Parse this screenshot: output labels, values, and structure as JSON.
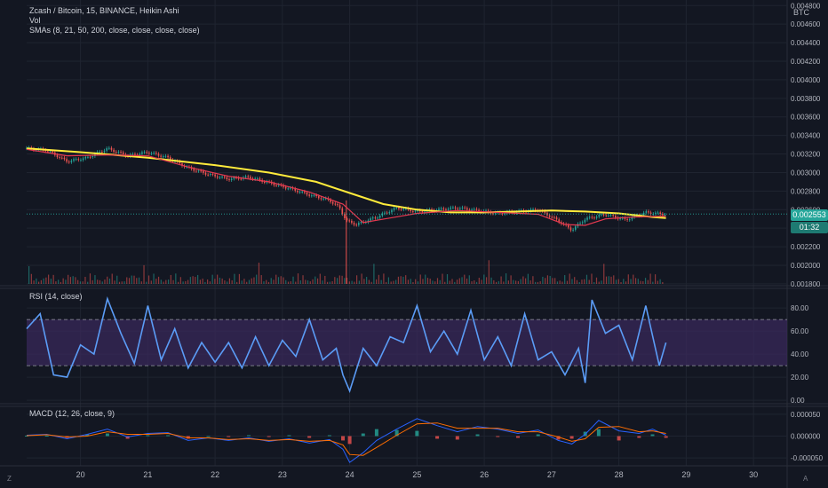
{
  "price_pane": {
    "title": "Zcash / Bitcoin, 15, BINANCE, Heikin Ashi",
    "vol_label": "Vol",
    "sma_label": "SMAs (8, 21, 50, 200, close, close, close, close)",
    "currency": "BTC",
    "current_price": "0.002553",
    "countdown": "01:32",
    "tag_color": "#26a69a"
  },
  "rsi_pane": {
    "title": "RSI (14, close)"
  },
  "macd_pane": {
    "title": "MACD (12, 26, close, 9)"
  },
  "time_axis": {
    "left_corner": "Z",
    "right_corner": "A"
  },
  "colors": {
    "background": "#131722",
    "grid": "#1f2430",
    "sma_yellow": "#ffeb3b",
    "sma_red": "#e53950",
    "rsi_line": "#5b9cf6",
    "rsi_band": "#3a2a5c",
    "up_candle": "#26a69a",
    "down_candle": "#ef5350"
  },
  "chart_data": [
    {
      "type": "line",
      "title": "Zcash / Bitcoin, 15, BINANCE, Heikin Ashi",
      "xlabel": "",
      "ylabel": "BTC",
      "x_ticks": [
        "20",
        "21",
        "22",
        "23",
        "24",
        "25",
        "26",
        "27",
        "28",
        "29",
        "30"
      ],
      "y_ticks": [
        "0.001800",
        "0.002000",
        "0.002200",
        "0.002400",
        "0.002600",
        "0.002800",
        "0.003000",
        "0.003200",
        "0.003400",
        "0.003600",
        "0.003800",
        "0.004000",
        "0.004200",
        "0.004400",
        "0.004600",
        "0.004800"
      ],
      "ylim": [
        0.00178,
        0.00486
      ],
      "x_range": [
        19.2,
        30.5
      ],
      "grid": true,
      "price_series": {
        "x": [
          19.2,
          19.5,
          19.8,
          20.1,
          20.4,
          20.7,
          21.0,
          21.3,
          21.6,
          21.9,
          22.2,
          22.5,
          22.8,
          23.1,
          23.4,
          23.7,
          23.85,
          23.95,
          24.1,
          24.4,
          24.7,
          25.0,
          25.3,
          25.6,
          25.9,
          26.2,
          26.5,
          26.8,
          27.1,
          27.3,
          27.5,
          27.8,
          28.1,
          28.4,
          28.7
        ],
        "y": [
          0.00326,
          0.00324,
          0.00312,
          0.00316,
          0.00326,
          0.00318,
          0.00322,
          0.00316,
          0.00305,
          0.00298,
          0.00293,
          0.00295,
          0.00289,
          0.00283,
          0.00276,
          0.0027,
          0.00262,
          0.00248,
          0.00244,
          0.00252,
          0.00262,
          0.00258,
          0.0026,
          0.00262,
          0.00259,
          0.00256,
          0.00258,
          0.0026,
          0.00248,
          0.00238,
          0.0025,
          0.00255,
          0.00249,
          0.00257,
          0.00255
        ]
      },
      "series": [
        {
          "name": "SMA 200",
          "color": "#ffeb3b",
          "x": [
            19.2,
            20.0,
            21.0,
            22.0,
            22.8,
            23.5,
            24.0,
            24.5,
            25.0,
            25.5,
            26.0,
            26.5,
            27.0,
            27.5,
            28.0,
            28.5,
            28.7
          ],
          "y": [
            0.00326,
            0.00322,
            0.00316,
            0.00308,
            0.003,
            0.0029,
            0.00278,
            0.00266,
            0.0026,
            0.00257,
            0.00257,
            0.00258,
            0.00259,
            0.00258,
            0.00256,
            0.00252,
            0.00251
          ]
        },
        {
          "name": "SMA 50",
          "color": "#e53950",
          "x": [
            19.2,
            19.8,
            20.4,
            21.0,
            21.6,
            22.2,
            22.8,
            23.4,
            23.9,
            24.2,
            24.6,
            25.0,
            25.6,
            26.2,
            26.8,
            27.2,
            27.5,
            27.8,
            28.2,
            28.7
          ],
          "y": [
            0.00325,
            0.00318,
            0.00319,
            0.00318,
            0.00306,
            0.00296,
            0.0029,
            0.00279,
            0.00266,
            0.00246,
            0.00251,
            0.00256,
            0.00259,
            0.00257,
            0.00255,
            0.00244,
            0.00243,
            0.0025,
            0.00252,
            0.00253
          ]
        }
      ]
    },
    {
      "type": "line",
      "title": "RSI (14, close)",
      "y_ticks": [
        "0.00",
        "20.00",
        "40.00",
        "60.00",
        "80.00"
      ],
      "ylim": [
        -3,
        97
      ],
      "x_range": [
        19.2,
        30.5
      ],
      "bands": [
        30,
        70
      ],
      "grid": true,
      "x": [
        19.2,
        19.4,
        19.6,
        19.8,
        20.0,
        20.2,
        20.4,
        20.6,
        20.8,
        21.0,
        21.2,
        21.4,
        21.6,
        21.8,
        22.0,
        22.2,
        22.4,
        22.6,
        22.8,
        23.0,
        23.2,
        23.4,
        23.6,
        23.8,
        23.9,
        24.0,
        24.2,
        24.4,
        24.6,
        24.8,
        25.0,
        25.2,
        25.4,
        25.6,
        25.8,
        26.0,
        26.2,
        26.4,
        26.6,
        26.8,
        27.0,
        27.2,
        27.4,
        27.5,
        27.6,
        27.8,
        28.0,
        28.2,
        28.4,
        28.6,
        28.7
      ],
      "y": [
        62,
        75,
        22,
        20,
        48,
        40,
        88,
        58,
        32,
        82,
        35,
        62,
        28,
        50,
        33,
        50,
        28,
        55,
        30,
        52,
        38,
        70,
        35,
        45,
        22,
        8,
        45,
        30,
        55,
        50,
        82,
        42,
        60,
        40,
        78,
        35,
        55,
        30,
        75,
        35,
        42,
        22,
        45,
        15,
        87,
        58,
        65,
        35,
        82,
        30,
        50
      ]
    },
    {
      "type": "line",
      "title": "MACD (12, 26, close, 9)",
      "y_ticks": [
        "-0.000050",
        "0.000000",
        "0.000050"
      ],
      "ylim": [
        -6.8e-05,
        6.8e-05
      ],
      "x_range": [
        19.2,
        30.5
      ],
      "grid": true,
      "x": [
        19.2,
        19.5,
        19.8,
        20.1,
        20.4,
        20.7,
        21.0,
        21.3,
        21.6,
        21.9,
        22.2,
        22.5,
        22.8,
        23.1,
        23.4,
        23.7,
        23.9,
        24.0,
        24.2,
        24.4,
        24.7,
        25.0,
        25.3,
        25.6,
        25.9,
        26.2,
        26.5,
        26.8,
        27.1,
        27.3,
        27.5,
        27.7,
        28.0,
        28.3,
        28.5,
        28.7
      ],
      "series": [
        {
          "name": "MACD",
          "color": "#2962ff",
          "values": [
            2e-06,
            4e-06,
            -6e-06,
            4e-06,
            1.6e-05,
            -2e-06,
            6e-06,
            8e-06,
            -1e-05,
            -4e-06,
            -1e-05,
            -4e-06,
            -1.2e-05,
            -6e-06,
            -1.6e-05,
            -8e-06,
            -3e-05,
            -6e-05,
            -3.8e-05,
            -1e-05,
            1.6e-05,
            4e-05,
            2.4e-05,
            1e-05,
            2.2e-05,
            1.6e-05,
            6e-06,
            1.4e-05,
            -1e-05,
            -1.8e-05,
            4e-06,
            3.6e-05,
            1.2e-05,
            6e-06,
            1.6e-05,
            2e-06
          ]
        },
        {
          "name": "Signal",
          "color": "#ff6d00",
          "values": [
            1e-06,
            3e-06,
            -2e-06,
            0.0,
            1e-05,
            4e-06,
            4e-06,
            6e-06,
            -4e-06,
            -4e-06,
            -8e-06,
            -6e-06,
            -1e-05,
            -8e-06,
            -1.2e-05,
            -1e-05,
            -2e-05,
            -4.2e-05,
            -4.4e-05,
            -2.6e-05,
            2e-06,
            2.8e-05,
            3e-05,
            1.8e-05,
            1.8e-05,
            1.8e-05,
            1e-05,
            1e-05,
            -2e-06,
            -1.2e-05,
            -6e-06,
            2e-05,
            2.2e-05,
            1e-05,
            1.2e-05,
            6e-06
          ]
        }
      ]
    }
  ]
}
